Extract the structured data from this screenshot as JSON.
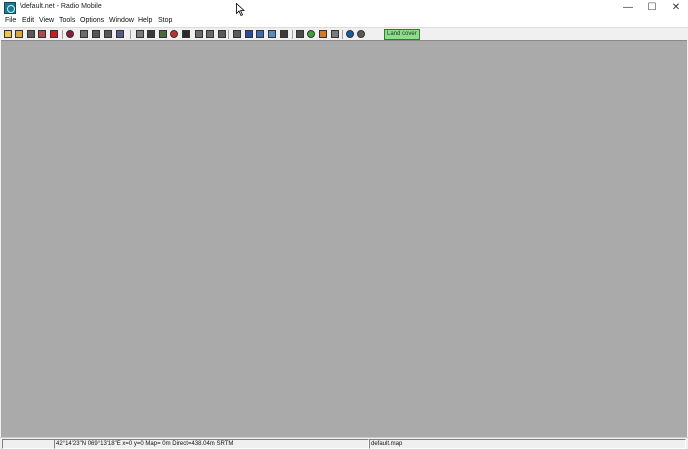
{
  "window": {
    "title": "\\default.net - Radio Mobile",
    "minimize": "—",
    "maximize": "☐",
    "close": "✕"
  },
  "menu": [
    "File",
    "Edit",
    "View",
    "Tools",
    "Options",
    "Window",
    "Help",
    "Stop"
  ],
  "toolbar": {
    "buttons": [
      {
        "name": "new-file-icon",
        "color": "#e8c64a"
      },
      {
        "name": "open-folder-icon",
        "color": "#d8a63a"
      },
      {
        "name": "save-icon",
        "color": "#5a5a5a"
      },
      {
        "name": "picture-icon",
        "color": "#b04848"
      },
      {
        "name": "properties-icon",
        "color": "#c02020"
      },
      {
        "name": "network-properties-icon",
        "color": "#8a1a3a"
      },
      {
        "name": "map-properties-icon",
        "color": "#6a6a6a"
      },
      {
        "name": "document-icon",
        "color": "#555555"
      },
      {
        "name": "print-icon",
        "color": "#555555"
      },
      {
        "name": "merge-icon",
        "color": "#5a5a8a"
      },
      {
        "name": "copy-icon",
        "color": "#7a7a7a"
      },
      {
        "name": "camera-icon",
        "color": "#3a3a3a"
      },
      {
        "name": "vehicle-icon",
        "color": "#4a6a3a"
      },
      {
        "name": "target-icon",
        "color": "#c03030"
      },
      {
        "name": "gradient-icon",
        "color": "#2a2a2a"
      },
      {
        "name": "elevation-icon",
        "color": "#6a6a6a"
      },
      {
        "name": "grid-icon",
        "color": "#6a6a6a"
      },
      {
        "name": "book-icon",
        "color": "#5a5a5a"
      },
      {
        "name": "frame-icon",
        "color": "#5a5a5a"
      },
      {
        "name": "map-blue-icon",
        "color": "#2a4aa0"
      },
      {
        "name": "map-zoom-icon",
        "color": "#3a6ab0"
      },
      {
        "name": "radio-coverage-icon",
        "color": "#5a8ac0"
      },
      {
        "name": "cross-icon",
        "color": "#3a3a3a"
      },
      {
        "name": "antenna-icon",
        "color": "#4a4a4a"
      },
      {
        "name": "green-circle-icon",
        "color": "#3aa03a"
      },
      {
        "name": "orange-map-icon",
        "color": "#d07a2a"
      },
      {
        "name": "striped-map-icon",
        "color": "#7a7a7a"
      },
      {
        "name": "globe-icon",
        "color": "#1a5aa0"
      },
      {
        "name": "satellite-icon",
        "color": "#5a5a5a"
      }
    ],
    "land_cover_label": "Land cover"
  },
  "status": {
    "panel1": "",
    "coordinates": "42°14'23\"N  069°13'18\"E    x=0 y=0 Map= 0m Direct=438.04m SRTM",
    "map_file": "default.map"
  }
}
